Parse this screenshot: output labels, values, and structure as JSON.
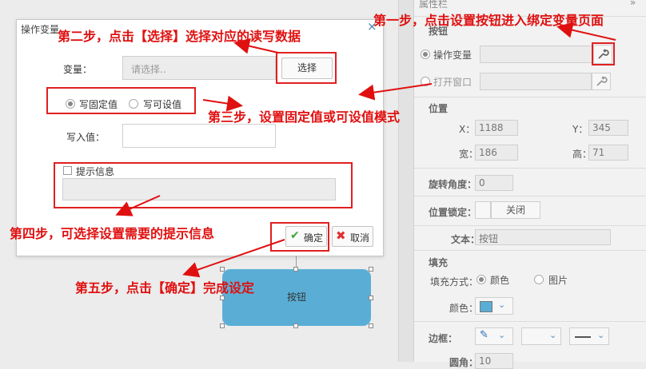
{
  "right_panel": {
    "title": "属性栏",
    "binding": {
      "section_title": "按钮",
      "operate_variable_label": "操作变量",
      "open_window_label": "打开窗口"
    },
    "position": {
      "section_title": "位置",
      "x_label": "X：",
      "x_value": "1188",
      "y_label": "Y：",
      "y_value": "345",
      "width_label": "宽：",
      "width_value": "186",
      "height_label": "高：",
      "height_value": "71"
    },
    "rotation_label": "旋转角度：",
    "rotation_value": "0",
    "position_lock_label": "位置锁定：",
    "position_lock_value": "关闭",
    "text_label": "文本：",
    "text_value": "按钮",
    "fill": {
      "section_title": "填充",
      "mode_label": "填充方式：",
      "option_color": "颜色",
      "option_image": "图片",
      "color_label": "颜色：",
      "color_value": "#5aaed6"
    },
    "border_label": "边框：",
    "corner_label": "圆角：",
    "corner_value": "10"
  },
  "dialog": {
    "title": "操作变量",
    "variable_label": "变量：",
    "variable_placeholder": "请选择..",
    "select_button": "选择",
    "mode_fixed": "写固定值",
    "mode_settable": "写可设值",
    "write_value_label": "写入值：",
    "write_value": "",
    "tip_label": "提示信息",
    "confirm_button": "确定",
    "cancel_button": "取消"
  },
  "canvas_button": {
    "label": "按钮",
    "color": "#5aaed6"
  },
  "annotations": {
    "step1": "第一步，点击设置按钮进入绑定变量页面",
    "step2": "第二步，点击【选择】选择对应的读写数据",
    "step3": "第三步，设置固定值或可设值模式",
    "step4": "第四步，可选择设置需要的提示信息",
    "step5": "第五步，点击【确定】完成设定"
  }
}
